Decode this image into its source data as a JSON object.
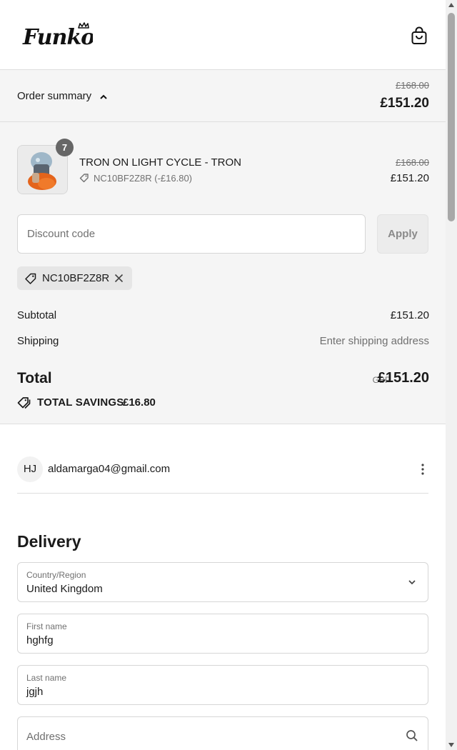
{
  "header": {
    "logo_text": "Funko",
    "bag_icon": "shopping-bag-icon"
  },
  "order_summary": {
    "toggle_label": "Order summary",
    "toggle_icon": "chevron-up-icon",
    "original_total": "£168.00",
    "total": "£151.20"
  },
  "product": {
    "quantity": "7",
    "title": "TRON ON LIGHT CYCLE - TRON",
    "discount_icon": "tag-icon",
    "discount": "NC10BF2Z8R (-£16.80)",
    "original_price": "£168.00",
    "price": "£151.20"
  },
  "discount": {
    "placeholder": "Discount code",
    "apply_label": "Apply",
    "applied_code": "NC10BF2Z8R"
  },
  "totals": {
    "subtotal_label": "Subtotal",
    "subtotal_value": "£151.20",
    "shipping_label": "Shipping",
    "shipping_value": "Enter shipping address",
    "total_label": "Total",
    "currency": "GBP",
    "total_value": "£151.20",
    "savings_label": "TOTAL SAVINGS",
    "savings_value": "£16.80"
  },
  "account": {
    "initials": "HJ",
    "email": "aldamarga04@gmail.com"
  },
  "delivery": {
    "heading": "Delivery",
    "country_label": "Country/Region",
    "country_value": "United Kingdom",
    "first_name_label": "First name",
    "first_name_value": "hghfg",
    "last_name_label": "Last name",
    "last_name_value": "jgjh",
    "address_placeholder": "Address"
  },
  "colors": {
    "summary_bg": "#f5f5f5",
    "badge_bg": "#666666",
    "border": "#d6d6d6"
  }
}
